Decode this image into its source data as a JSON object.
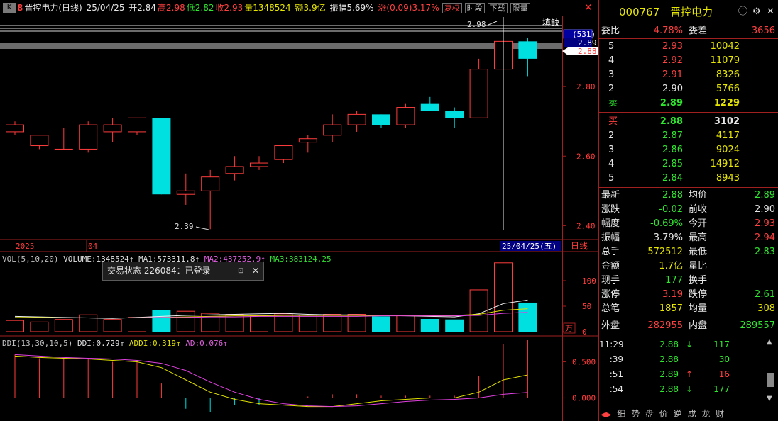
{
  "topbar": {
    "k_icon": "K",
    "r_icon": "8",
    "title": "晋控电力(日线)",
    "date": "25/04/25",
    "open": "开2.84",
    "high": "高2.98",
    "low": "低2.82",
    "close": "收2.93",
    "volume": "量1348524",
    "amount": "额3.9亿",
    "amplitude": "振幅5.69%",
    "change": "涨(0.09)3.17%",
    "btn_restore": "复权",
    "btn_time": "时段",
    "btn_download": "下载",
    "btn_limit": "限量",
    "close_icon": "✕"
  },
  "price_axis": {
    "labels": [
      "2.80",
      "2.60",
      "2.40"
    ],
    "current_box": "(531)",
    "current_price": "2.89",
    "bid_price": "2.88"
  },
  "annotations": {
    "high_label": "2.98",
    "low_label": "2.39",
    "fill_gap": "填缺"
  },
  "date_axis": {
    "year": "2025",
    "month": "04",
    "cursor_date": "25/04/25(五)",
    "period": "日线"
  },
  "vol_header": {
    "name": "VOL(5,10,20)",
    "volume": "VOLUME:1348524",
    "ma1": "MA1:573311.8",
    "ma2": "MA2:437252.9",
    "ma3": "MA3:383124.25"
  },
  "vol_axis": {
    "labels": [
      "100",
      "50",
      "0"
    ],
    "unit": "万"
  },
  "ddi_header": {
    "name": "DDI(13,30,10,5)",
    "ddi": "DDI:0.729",
    "addi": "ADDI:0.319",
    "ad": "AD:0.076"
  },
  "ddi_axis": {
    "labels": [
      "0.500",
      "0.000"
    ]
  },
  "tooltip": {
    "text": "交易状态 226084：已登录",
    "pin": "⊡",
    "close": "✕"
  },
  "panel": {
    "code": "000767",
    "name": "晋控电力",
    "commission_ratio_label": "委比",
    "commission_ratio": "4.78%",
    "commission_diff_label": "委差",
    "commission_diff": "3656",
    "asks": [
      {
        "level": "5",
        "price": "2.93",
        "vol": "10042"
      },
      {
        "level": "4",
        "price": "2.92",
        "vol": "11079"
      },
      {
        "level": "3",
        "price": "2.91",
        "vol": "8326"
      },
      {
        "level": "2",
        "price": "2.90",
        "vol": "5766"
      },
      {
        "level": "卖",
        "price": "2.89",
        "vol": "1229"
      }
    ],
    "bids": [
      {
        "level": "买",
        "price": "2.88",
        "vol": "3102"
      },
      {
        "level": "2",
        "price": "2.87",
        "vol": "4117"
      },
      {
        "level": "3",
        "price": "2.86",
        "vol": "9024"
      },
      {
        "level": "4",
        "price": "2.85",
        "vol": "14912"
      },
      {
        "level": "5",
        "price": "2.84",
        "vol": "8943"
      }
    ],
    "stats": [
      {
        "l1": "最新",
        "v1": "2.88",
        "c1": "green",
        "l2": "均价",
        "v2": "2.89",
        "c2": "green"
      },
      {
        "l1": "涨跌",
        "v1": "-0.02",
        "c1": "green",
        "l2": "前收",
        "v2": "2.90",
        "c2": "white"
      },
      {
        "l1": "幅度",
        "v1": "-0.69%",
        "c1": "green",
        "l2": "今开",
        "v2": "2.93",
        "c2": "red"
      },
      {
        "l1": "振幅",
        "v1": "3.79%",
        "c1": "white",
        "l2": "最高",
        "v2": "2.94",
        "c2": "red"
      },
      {
        "l1": "总手",
        "v1": "572512",
        "c1": "yellow",
        "l2": "最低",
        "v2": "2.83",
        "c2": "green"
      },
      {
        "l1": "金额",
        "v1": "1.7亿",
        "c1": "yellow",
        "l2": "量比",
        "v2": "–",
        "c2": "white"
      },
      {
        "l1": "现手",
        "v1": "177",
        "c1": "green",
        "l2": "换手",
        "v2": "",
        "c2": "white"
      },
      {
        "l1": "涨停",
        "v1": "3.19",
        "c1": "red",
        "l2": "跌停",
        "v2": "2.61",
        "c2": "green"
      },
      {
        "l1": "总笔",
        "v1": "1857",
        "c1": "yellow",
        "l2": "均量",
        "v2": "308",
        "c2": "yellow"
      }
    ],
    "outer_label": "外盘",
    "outer": "282955",
    "inner_label": "内盘",
    "inner": "289557",
    "ticks": [
      {
        "time": "11:29",
        "price": "2.88",
        "dir": "↓",
        "vol": "117",
        "color": "green"
      },
      {
        "time": ":39",
        "price": "2.88",
        "dir": "",
        "vol": "30",
        "color": "green"
      },
      {
        "time": ":51",
        "price": "2.89",
        "dir": "↑",
        "vol": "16",
        "color": "red"
      },
      {
        "time": ":54",
        "price": "2.88",
        "dir": "↓",
        "vol": "177",
        "color": "green"
      }
    ],
    "tabs": [
      "细",
      "势",
      "盘",
      "价",
      "逆",
      "成",
      "龙",
      "财"
    ]
  },
  "chart_data": {
    "type": "candlestick",
    "price_range": [
      2.36,
      3.0
    ],
    "candles": [
      {
        "o": 2.67,
        "c": 2.69,
        "h": 2.7,
        "l": 2.66,
        "v": 22
      },
      {
        "o": 2.63,
        "c": 2.66,
        "h": 2.66,
        "l": 2.62,
        "v": 19
      },
      {
        "o": 2.62,
        "c": 2.62,
        "h": 2.68,
        "l": 2.62,
        "v": 24
      },
      {
        "o": 2.62,
        "c": 2.69,
        "h": 2.7,
        "l": 2.61,
        "v": 33
      },
      {
        "o": 2.67,
        "c": 2.69,
        "h": 2.71,
        "l": 2.64,
        "v": 24
      },
      {
        "o": 2.67,
        "c": 2.71,
        "h": 2.71,
        "l": 2.66,
        "v": 28
      },
      {
        "o": 2.71,
        "c": 2.49,
        "h": 2.71,
        "l": 2.49,
        "v": 42
      },
      {
        "o": 2.49,
        "c": 2.5,
        "h": 2.55,
        "l": 2.46,
        "v": 40
      },
      {
        "o": 2.5,
        "c": 2.54,
        "h": 2.56,
        "l": 2.39,
        "v": 36
      },
      {
        "o": 2.55,
        "c": 2.57,
        "h": 2.6,
        "l": 2.53,
        "v": 34
      },
      {
        "o": 2.57,
        "c": 2.58,
        "h": 2.6,
        "l": 2.56,
        "v": 32
      },
      {
        "o": 2.59,
        "c": 2.63,
        "h": 2.63,
        "l": 2.58,
        "v": 35
      },
      {
        "o": 2.64,
        "c": 2.65,
        "h": 2.66,
        "l": 2.61,
        "v": 32
      },
      {
        "o": 2.66,
        "c": 2.69,
        "h": 2.72,
        "l": 2.64,
        "v": 34
      },
      {
        "o": 2.69,
        "c": 2.72,
        "h": 2.73,
        "l": 2.67,
        "v": 34
      },
      {
        "o": 2.72,
        "c": 2.69,
        "h": 2.72,
        "l": 2.68,
        "v": 30
      },
      {
        "o": 2.69,
        "c": 2.74,
        "h": 2.75,
        "l": 2.68,
        "v": 32
      },
      {
        "o": 2.75,
        "c": 2.73,
        "h": 2.77,
        "l": 2.73,
        "v": 25
      },
      {
        "o": 2.73,
        "c": 2.71,
        "h": 2.74,
        "l": 2.68,
        "v": 24
      },
      {
        "o": 2.71,
        "c": 2.85,
        "h": 2.88,
        "l": 2.71,
        "v": 82
      },
      {
        "o": 2.85,
        "c": 2.93,
        "h": 2.98,
        "l": 2.82,
        "v": 135
      },
      {
        "o": 2.93,
        "c": 2.88,
        "h": 2.94,
        "l": 2.83,
        "v": 57
      }
    ],
    "ma_vol": {
      "ma1": [
        30,
        29,
        28,
        27,
        26,
        28,
        30,
        32,
        33,
        34,
        35,
        36,
        34,
        33,
        33,
        32,
        31,
        30,
        29,
        35,
        55,
        62
      ],
      "ma2": [
        28,
        28,
        27,
        27,
        27,
        27,
        28,
        29,
        30,
        31,
        31,
        32,
        32,
        32,
        32,
        32,
        32,
        32,
        32,
        34,
        42,
        45
      ],
      "ma3": [
        27,
        27,
        27,
        27,
        27,
        27,
        28,
        28,
        29,
        29,
        30,
        30,
        30,
        30,
        30,
        31,
        31,
        31,
        31,
        32,
        36,
        38
      ]
    },
    "ddi": {
      "range": [
        -0.3,
        0.8
      ],
      "ddi": [
        0.6,
        0.55,
        0.55,
        0.55,
        0.5,
        0.5,
        0.2,
        -0.15,
        -0.2,
        -0.1,
        -0.1,
        0.0,
        0.02,
        0.05,
        0.05,
        0.03,
        0.03,
        0.03,
        0.03,
        0.3,
        0.75,
        0.8
      ],
      "addi": [
        0.58,
        0.56,
        0.55,
        0.54,
        0.52,
        0.5,
        0.42,
        0.25,
        0.08,
        -0.02,
        -0.08,
        -0.1,
        -0.12,
        -0.12,
        -0.08,
        -0.04,
        -0.02,
        0.0,
        0.0,
        0.08,
        0.25,
        0.319
      ],
      "ad": [
        0.6,
        0.58,
        0.56,
        0.55,
        0.54,
        0.52,
        0.48,
        0.38,
        0.22,
        0.08,
        -0.02,
        -0.08,
        -0.11,
        -0.12,
        -0.11,
        -0.08,
        -0.05,
        -0.03,
        -0.02,
        0.0,
        0.05,
        0.076
      ]
    }
  }
}
